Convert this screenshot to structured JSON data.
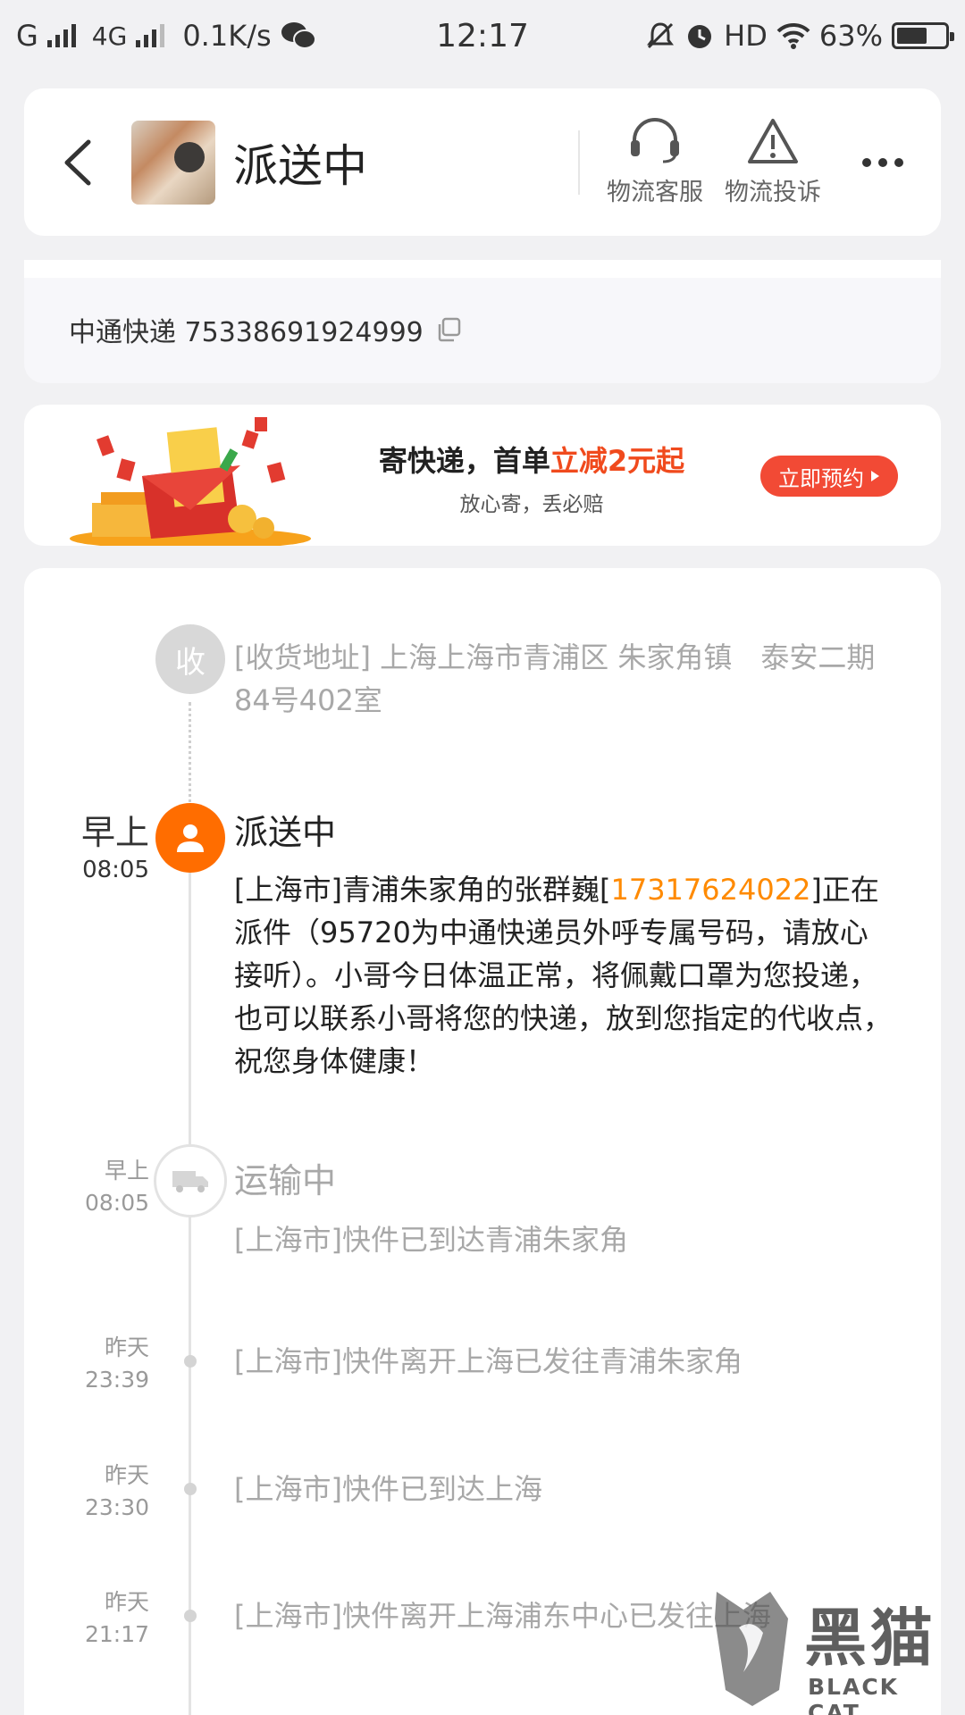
{
  "status_bar": {
    "carrier": "G",
    "network": "4G",
    "speed": "0.1K/s",
    "time": "12:17",
    "hd": "HD",
    "battery": "63%",
    "battery_level": 0.63
  },
  "header": {
    "title": "派送中",
    "buttons": [
      {
        "label": "物流客服",
        "icon": "headset-icon"
      },
      {
        "label": "物流投诉",
        "icon": "warning-icon"
      }
    ]
  },
  "tracking": {
    "courier_number": "中通快递 75338691924999",
    "copy_icon": "copy-icon"
  },
  "promo": {
    "title_prefix": "寄快递，首单",
    "title_highlight": "立减2元起",
    "subtitle": "放心寄，丢必赔",
    "button_label": "立即预约",
    "accent_color": "#f04a1d"
  },
  "timeline": {
    "receive_node": "收",
    "address": "[收货地址] 上海上海市青浦区 朱家角镇　泰安二期84号402室",
    "events": [
      {
        "day": "早上",
        "time": "08:05",
        "status": "派送中",
        "desc_before": "[上海市]青浦朱家角的张群巍[",
        "phone": "17317624022",
        "desc_after": "]正在派件（95720为中通快递员外呼专属号码，请放心接听）。小哥今日体温正常，将佩戴口罩为您投递，也可以联系小哥将您的快递，放到您指定的代收点，祝您身体健康！"
      },
      {
        "day": "早上",
        "time": "08:05",
        "status": "运输中",
        "desc": "[上海市]快件已到达青浦朱家角"
      },
      {
        "day": "昨天",
        "time": "23:39",
        "desc": "[上海市]快件离开上海已发往青浦朱家角"
      },
      {
        "day": "昨天",
        "time": "23:30",
        "desc": "[上海市]快件已到达上海"
      },
      {
        "day": "昨天",
        "time": "21:17",
        "desc": "[上海市]快件离开上海浦东中心已发往上海"
      }
    ]
  },
  "watermark": {
    "text": "黑猫",
    "sub": "BLACK CAT"
  }
}
